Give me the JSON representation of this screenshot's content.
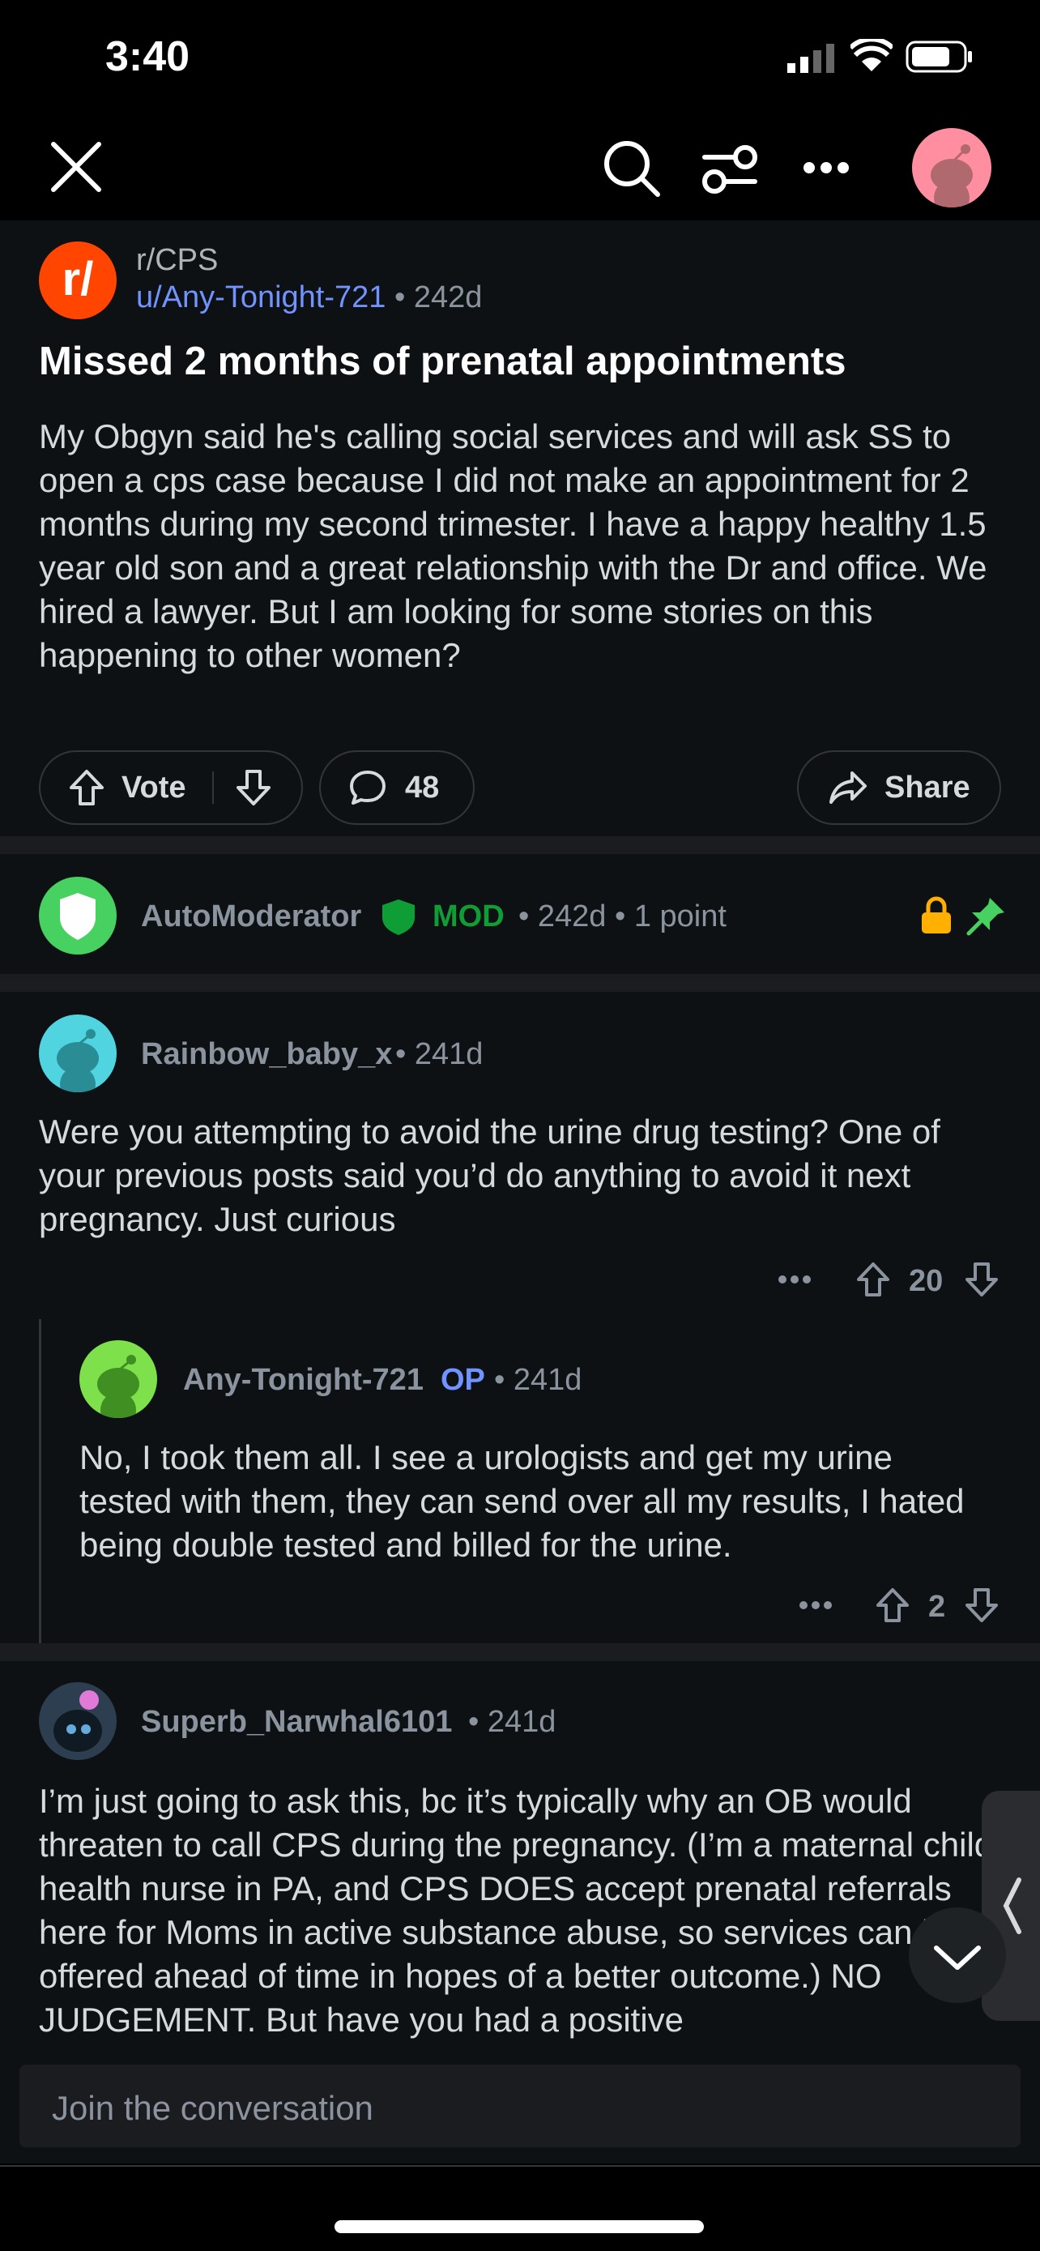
{
  "status_bar": {
    "time": "3:40"
  },
  "post": {
    "subreddit": "r/CPS",
    "author": "u/Any-Tonight-721",
    "age": "242d",
    "title": "Missed 2 months of prenatal appointments",
    "body": "My Obgyn said he's calling social services and will ask SS to open a cps case because I did not make an appointment for 2 months during my second trimester. I have a happy healthy 1.5 year old son and a great relationship with the Dr and office. We hired a lawyer. But I am looking for some stories on this happening to other women?",
    "vote_label": "Vote",
    "comment_count": "48",
    "share_label": "Share"
  },
  "automod": {
    "username": "AutoModerator",
    "badge": "MOD",
    "age": "242d",
    "points": "1 point"
  },
  "comments": [
    {
      "username": "Rainbow_baby_x",
      "age": "241d",
      "text": "Were you attempting to avoid the urine drug testing? One of your previous posts said you’d do anything to avoid it next pregnancy. Just curious",
      "score": "20"
    },
    {
      "username": "Any-Tonight-721",
      "op_badge": "OP",
      "age": "241d",
      "text": "No, I took them all. I see a urologists and get my urine tested with them, they can send over all my results, I hated being double tested and billed for the urine.",
      "score": "2"
    },
    {
      "username": "Superb_Narwhal6101",
      "age": "241d",
      "text": "I’m just going to ask this, bc it’s typically why an OB would threaten to call CPS during the pregnancy. (I’m a maternal child health nurse in PA, and CPS DOES accept prenatal referrals here for Moms in active substance abuse, so services can be offered ahead of time in hopes of a better outcome.) NO JUDGEMENT. But have you had a positive"
    }
  ],
  "composer": {
    "placeholder": "Join the conversation"
  },
  "colors": {
    "accent_blue": "#7193ff",
    "mod_green": "#46d160",
    "brand_orange": "#ff4500",
    "lock_yellow": "#ffb000"
  }
}
